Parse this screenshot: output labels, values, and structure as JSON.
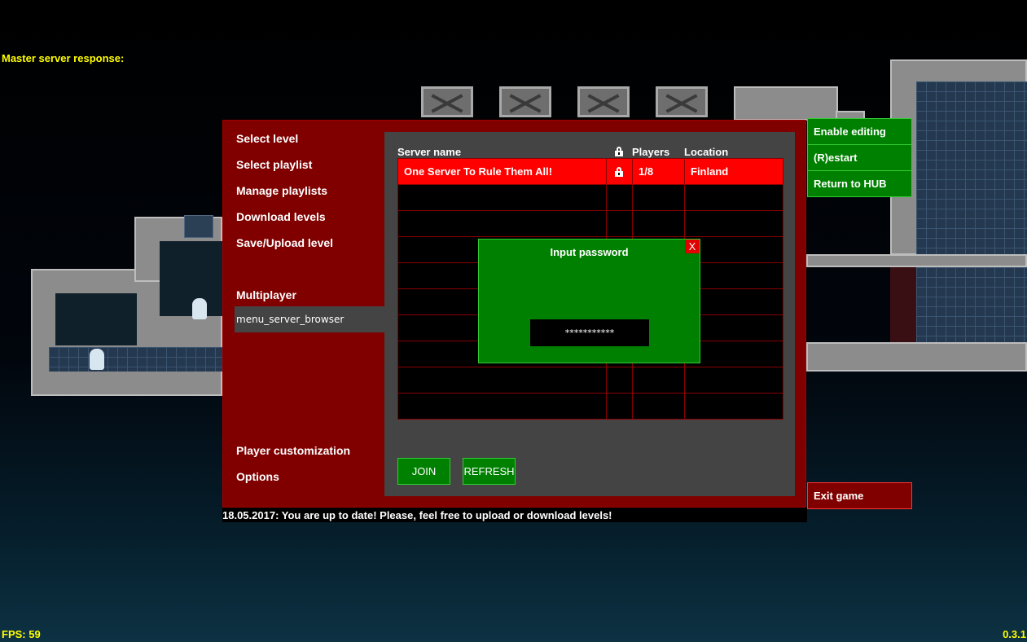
{
  "hud": {
    "master_server_response": "Master server response:",
    "fps": "FPS: 59",
    "version": "0.3.1"
  },
  "menu": {
    "items": [
      {
        "label": "Select level"
      },
      {
        "label": "Select playlist"
      },
      {
        "label": "Manage playlists"
      },
      {
        "label": "Download levels"
      },
      {
        "label": "Save/Upload level"
      },
      {
        "label": "Multiplayer"
      },
      {
        "label": "menu_server_browser"
      },
      {
        "label": "Player customization"
      },
      {
        "label": "Options"
      }
    ]
  },
  "server_browser": {
    "columns": {
      "name": "Server name",
      "locked_icon": "lock-icon",
      "players": "Players",
      "location": "Location"
    },
    "rows": [
      {
        "name": "One Server To Rule Them All!",
        "locked": true,
        "players": "1/8",
        "location": "Finland"
      }
    ],
    "join_label": "JOIN",
    "refresh_label": "REFRESH"
  },
  "password_dialog": {
    "title": "Input password",
    "close_label": "X",
    "value": "***********"
  },
  "side_buttons": {
    "enable_editing": "Enable editing",
    "restart": "(R)estart",
    "return_hub": "Return to HUB",
    "exit_game": "Exit game"
  },
  "news": "18.05.2017: You are up to date! Please, feel free to upload or download levels!",
  "colors": {
    "panel": "#800000",
    "browser": "#444444",
    "selected_row": "#ff0000",
    "button_green": "#008000",
    "hud_yellow": "#ffff00"
  }
}
